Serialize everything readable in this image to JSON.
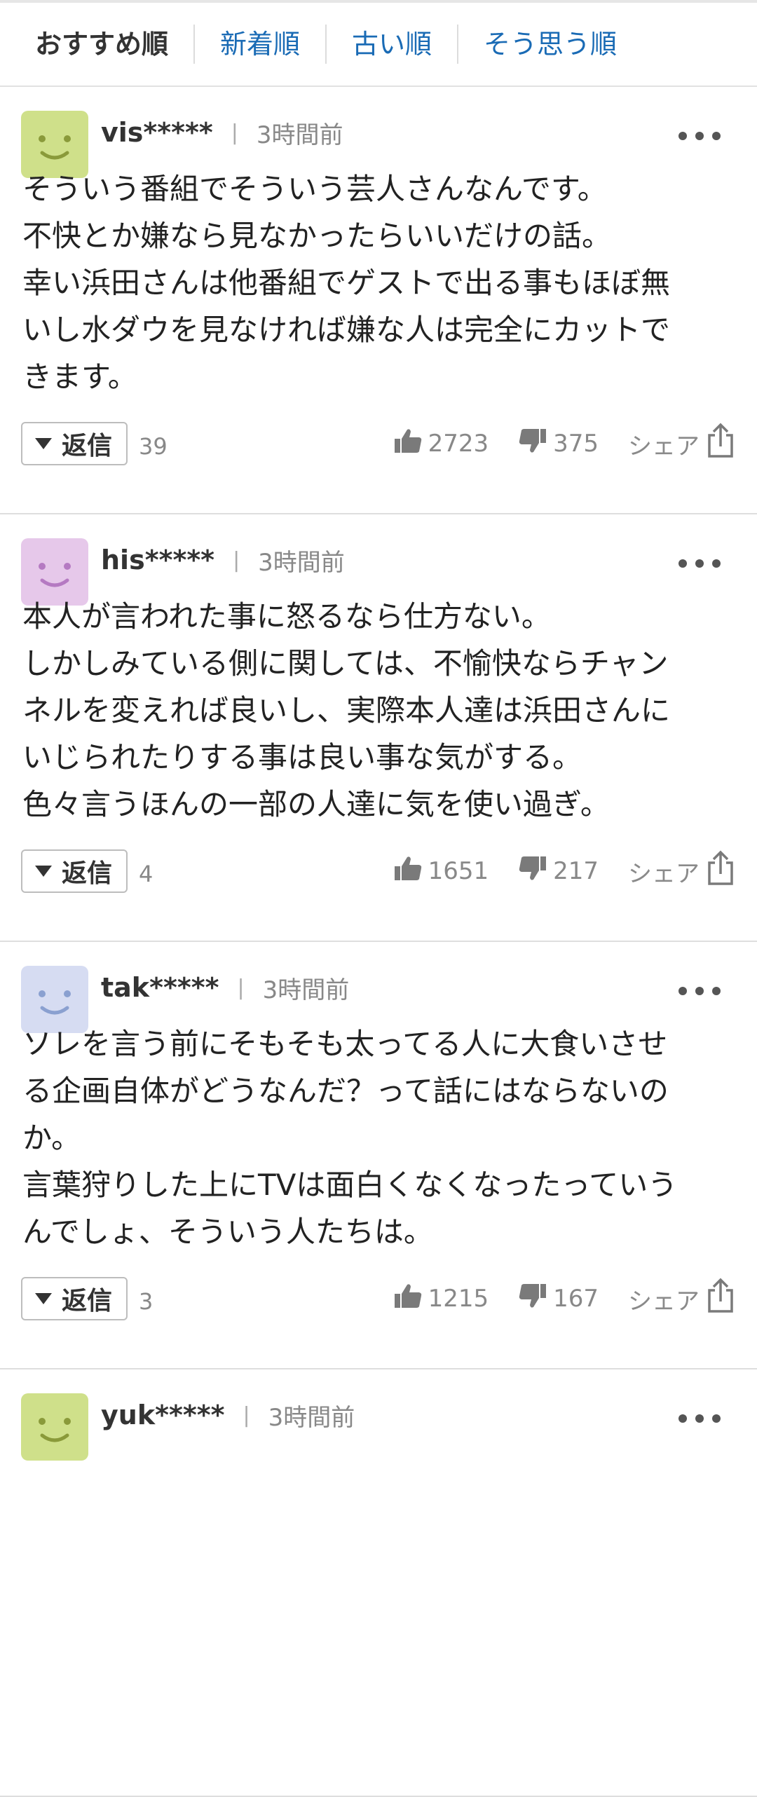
{
  "sort": {
    "active": "おすすめ順",
    "newest": "新着順",
    "oldest": "古い順",
    "agree": "そう思う順"
  },
  "labels": {
    "reply": "返信",
    "share": "シェア",
    "divider": "|"
  },
  "comments": [
    {
      "username": "vis*****",
      "time": "3時間前",
      "avatar_color": "#cfe08a",
      "face_color": "#8a9a3a",
      "lines": [
        "そういう番組でそういう芸人さんなんです。",
        "不快とか嫌なら見なかったらいいだけの話。",
        "幸い浜田さんは他番組でゲストで出る事もほぼ無",
        "いし水ダウを見なければ嫌な人は完全にカットで",
        "きます。"
      ],
      "replies": "39",
      "likes": "2723",
      "dislikes": "375"
    },
    {
      "username": "his*****",
      "time": "3時間前",
      "avatar_color": "#e6c8ea",
      "face_color": "#b57ac2",
      "lines": [
        "本人が言われた事に怒るなら仕方ない。",
        "しかしみている側に関しては、不愉快ならチャン",
        "ネルを変えれば良いし、実際本人達は浜田さんに",
        "いじられたりする事は良い事な気がする。",
        "色々言うほんの一部の人達に気を使い過ぎ。"
      ],
      "replies": "4",
      "likes": "1651",
      "dislikes": "217"
    },
    {
      "username": "tak*****",
      "time": "3時間前",
      "avatar_color": "#d6dcf2",
      "face_color": "#8aa0d0",
      "lines": [
        "ソレを言う前にそもそも太ってる人に大食いさせ",
        "る企画自体がどうなんだ？って話にはならないの",
        "か。",
        "言葉狩りした上にTVは面白くなくなったっていう",
        "んでしょ、そういう人たちは。"
      ],
      "replies": "3",
      "likes": "1215",
      "dislikes": "167"
    },
    {
      "username": "yuk*****",
      "time": "3時間前",
      "avatar_color": "#cfe08a",
      "face_color": "#8a9a3a",
      "lines": [],
      "replies": "",
      "likes": "",
      "dislikes": ""
    }
  ]
}
